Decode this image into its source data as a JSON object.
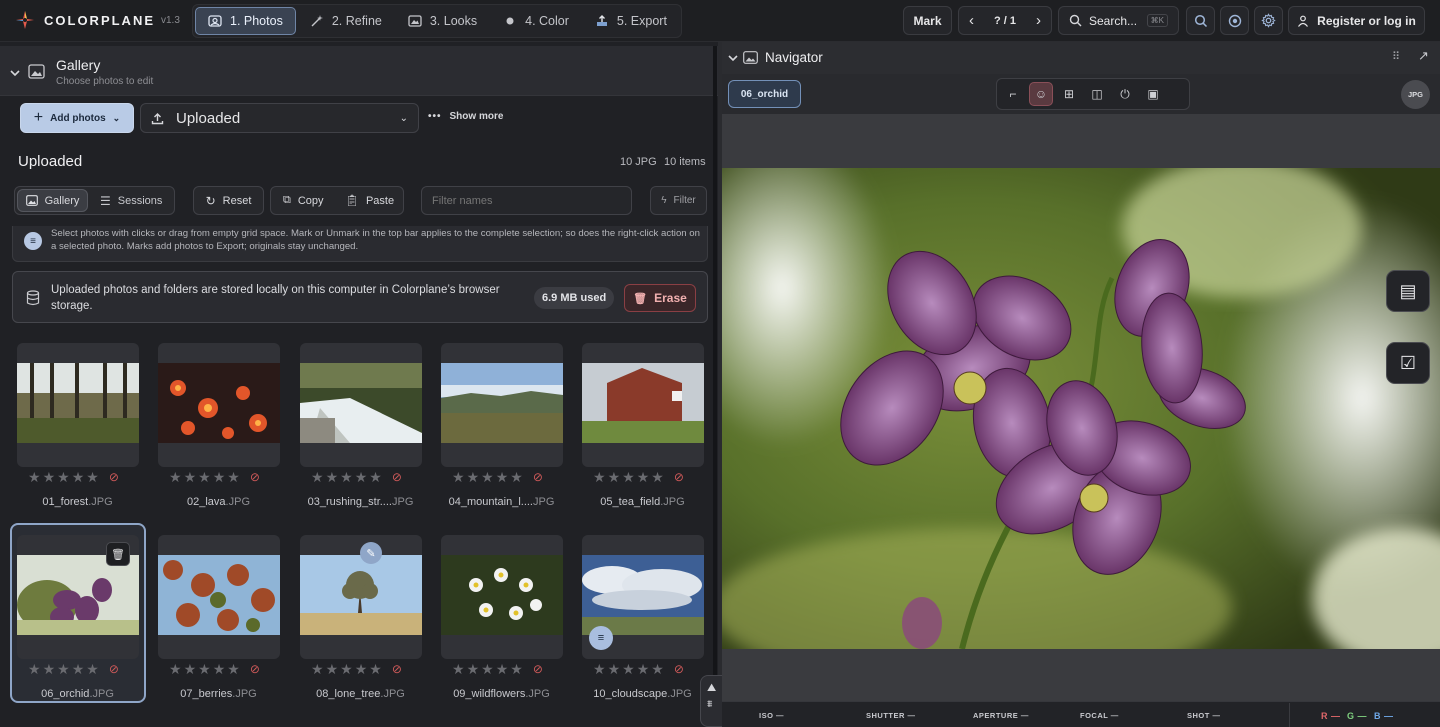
{
  "app": {
    "name": "COLORPLANE",
    "version": "v1.3"
  },
  "steps": [
    {
      "label": "1. Photos",
      "icon": "photo-icon"
    },
    {
      "label": "2. Refine",
      "icon": "wand-icon"
    },
    {
      "label": "3. Looks",
      "icon": "looks-icon"
    },
    {
      "label": "4. Color",
      "icon": "color-dot-icon"
    },
    {
      "label": "5. Export",
      "icon": "export-icon"
    }
  ],
  "topbar": {
    "mark": "Mark",
    "counter": "? / 1",
    "search": "Search...",
    "search_shortcut": "⌘K",
    "register": "Register or log in"
  },
  "gallery": {
    "title": "Gallery",
    "subtitle": "Choose photos to edit",
    "add_photos": "Add photos",
    "source": "Uploaded",
    "show_more": "Show more",
    "section_title": "Uploaded",
    "count_jpg": "10 JPG",
    "count_items": "10 items",
    "tabs": {
      "gallery": "Gallery",
      "sessions": "Sessions"
    },
    "reset": "Reset",
    "copy": "Copy",
    "paste": "Paste",
    "filter_placeholder": "Filter names",
    "filter": "Filter",
    "tip": "Select photos with clicks or drag from empty grid space. Mark or Unmark in the top bar applies to the complete selection; so does the right-click action on a selected photo. Marks add photos to Export; originals stay unchanged.",
    "storage_text": "Uploaded photos and folders are stored locally on this computer in Colorplane’s browser storage.",
    "storage_used": "6.9 MB used",
    "erase": "Erase",
    "photos": [
      {
        "name": "01_forest",
        "ext": ".JPG",
        "rating": 0
      },
      {
        "name": "02_lava",
        "ext": ".JPG",
        "rating": 0
      },
      {
        "name": "03_rushing_str....",
        "ext": "JPG",
        "rating": 0
      },
      {
        "name": "04_mountain_l....",
        "ext": "JPG",
        "rating": 0
      },
      {
        "name": "05_tea_field",
        "ext": ".JPG",
        "rating": 0
      },
      {
        "name": "06_orchid",
        "ext": ".JPG",
        "rating": 0
      },
      {
        "name": "07_berries",
        "ext": ".JPG",
        "rating": 0
      },
      {
        "name": "08_lone_tree",
        "ext": ".JPG",
        "rating": 0
      },
      {
        "name": "09_wildflowers",
        "ext": ".JPG",
        "rating": 0
      },
      {
        "name": "10_cloudscape",
        "ext": ".JPG",
        "rating": 0
      }
    ]
  },
  "navigator": {
    "title": "Navigator",
    "current": "06_orchid",
    "format": "JPG",
    "exif": [
      {
        "label": "ISO",
        "value": "—"
      },
      {
        "label": "SHUTTER",
        "value": "—"
      },
      {
        "label": "APERTURE",
        "value": "—"
      },
      {
        "label": "FOCAL",
        "value": "—"
      },
      {
        "label": "SHOT",
        "value": "—"
      }
    ],
    "rgb": {
      "r": "R —",
      "g": "G —",
      "b": "B —"
    }
  },
  "colors": {
    "accent": "#6f85a6",
    "danger": "#e06a6a",
    "panel": "#202125"
  }
}
